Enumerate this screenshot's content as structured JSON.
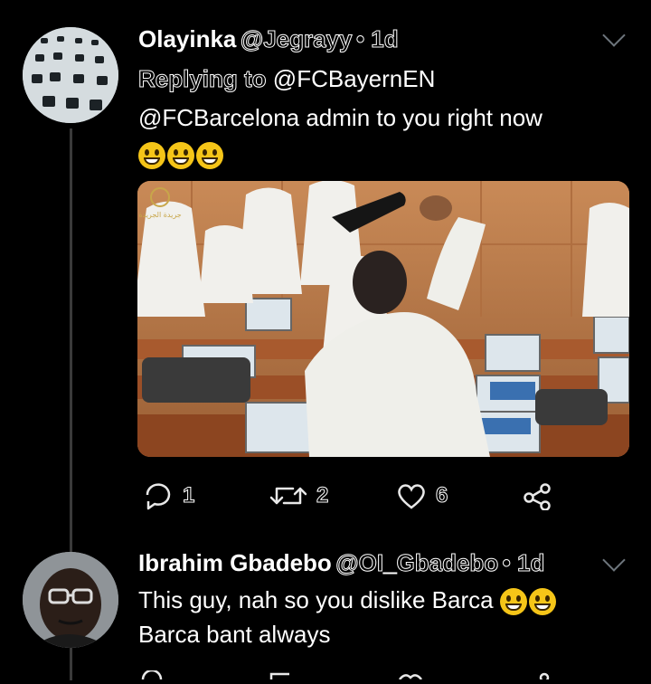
{
  "tweet1": {
    "name": "Olayinka",
    "handle": "@Jegrayy",
    "time": "• 1d",
    "reply_label": "Replying to",
    "reply_target": "@FCBayernEN",
    "text": "@FCBarcelona admin to you right now",
    "emojis": [
      "grinning-face-icon",
      "grinning-face-icon",
      "grinning-face-icon"
    ],
    "photo_watermark": "جريدة الجريدة",
    "actions": {
      "replies": "1",
      "retweets": "2",
      "likes": "6"
    }
  },
  "tweet2": {
    "name": "Ibrahim Gbadebo",
    "handle": "@OI_Gbadebo",
    "time": "• 1d",
    "line1": "This guy, nah so you dislike Barca",
    "line2": "Barca bant always",
    "emojis": [
      "tears-of-joy-icon",
      "tears-of-joy-icon"
    ]
  },
  "colors": {
    "background": "#000000",
    "muted": "#6e767d",
    "thread_line": "#3a3a3a"
  }
}
